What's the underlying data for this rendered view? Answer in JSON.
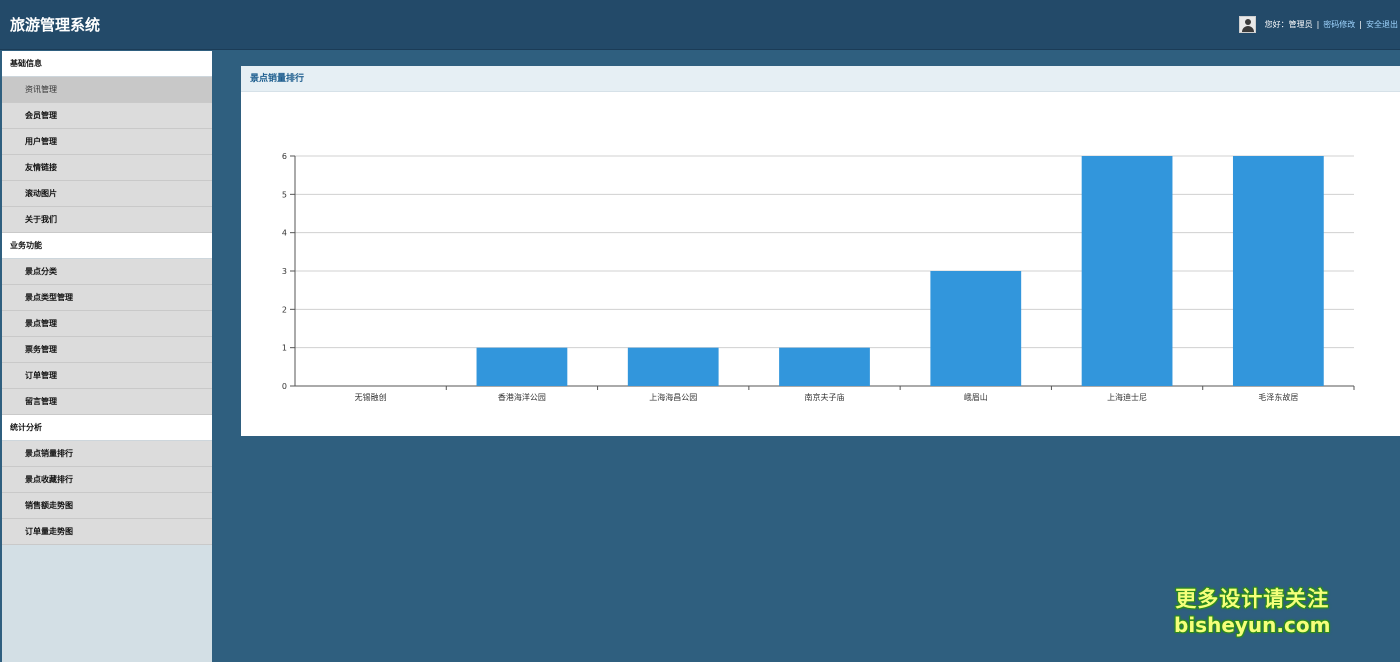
{
  "header": {
    "title": "旅游管理系统",
    "greeting": "您好：管理员",
    "change_password": "密码修改",
    "logout": "安全退出",
    "separator": "|"
  },
  "sidebar": {
    "groups": [
      {
        "title": "基础信息",
        "items": [
          "资讯管理",
          "会员管理",
          "用户管理",
          "友情链接",
          "滚动图片",
          "关于我们"
        ]
      },
      {
        "title": "业务功能",
        "items": [
          "景点分类",
          "景点类型管理",
          "景点管理",
          "票务管理",
          "订单管理",
          "留言管理"
        ]
      },
      {
        "title": "统计分析",
        "items": [
          "景点销量排行",
          "景点收藏排行",
          "销售额走势图",
          "订单量走势图"
        ]
      }
    ],
    "active_item": "资讯管理"
  },
  "panel": {
    "title": "景点销量排行"
  },
  "chart_data": {
    "type": "bar",
    "categories": [
      "无锡融创",
      "香港海洋公园",
      "上海海昌公园",
      "南京夫子庙",
      "峨眉山",
      "上海迪士尼",
      "毛泽东故居"
    ],
    "values": [
      0,
      1,
      1,
      1,
      3,
      6,
      6
    ],
    "ylim": [
      0,
      6
    ],
    "yticks": [
      0,
      1,
      2,
      3,
      4,
      5,
      6
    ],
    "grid": true,
    "bar_color": "#3296dc"
  },
  "watermark": {
    "line1": "更多设计请关注",
    "line2": "bisheyun.com"
  }
}
